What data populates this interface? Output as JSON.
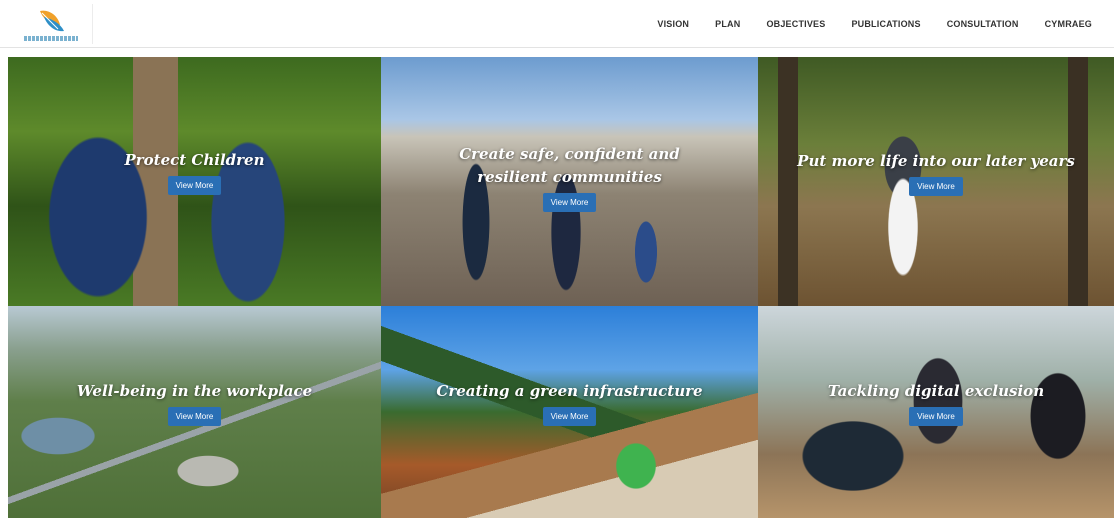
{
  "brand": {
    "logo_icon": "feather-leaf-logo-icon"
  },
  "nav": {
    "items": [
      {
        "label": "VISION"
      },
      {
        "label": "PLAN"
      },
      {
        "label": "OBJECTIVES"
      },
      {
        "label": "PUBLICATIONS"
      },
      {
        "label": "CONSULTATION"
      },
      {
        "label": "CYMRAEG"
      }
    ]
  },
  "tiles": [
    {
      "title": "Protect Children",
      "button": "View More"
    },
    {
      "title": "Create safe, confident and resilient communities",
      "button": "View More"
    },
    {
      "title": "Put more life into our later years",
      "button": "View More"
    },
    {
      "title": "Well-being in the workplace",
      "button": "View More"
    },
    {
      "title": "Creating a green infrastructure",
      "button": "View More"
    },
    {
      "title": "Tackling digital exclusion",
      "button": "View More"
    }
  ],
  "colors": {
    "accent": "#2a6fb5",
    "nav_text": "#333333"
  }
}
